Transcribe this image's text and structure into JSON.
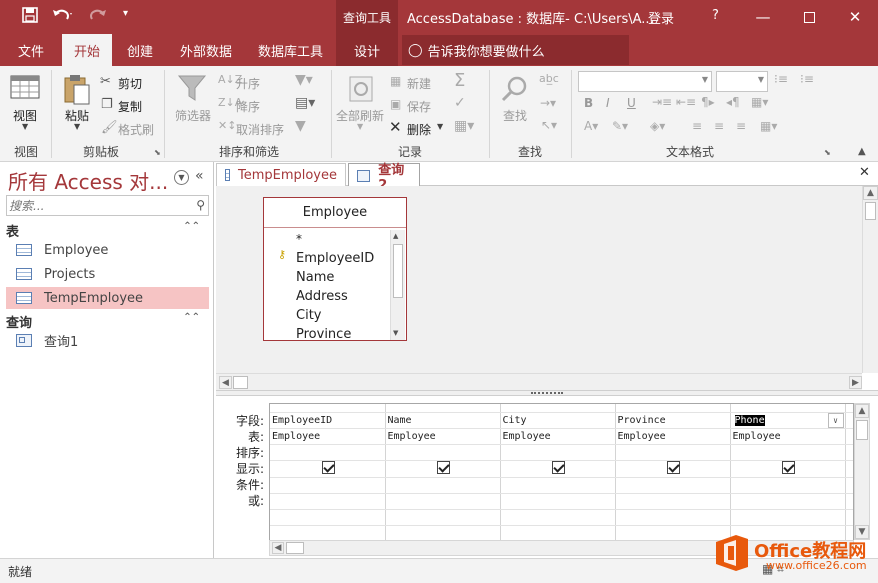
{
  "titlebar": {
    "context_tab": "查询工具",
    "title": "AccessDatabase : 数据库- C:\\Users\\A...",
    "signin": "登录",
    "help": "?"
  },
  "ribbon_tabs": [
    "文件",
    "开始",
    "创建",
    "外部数据",
    "数据库工具",
    "设计"
  ],
  "tell_me": "告诉我你想要做什么",
  "ribbon": {
    "view": {
      "label": "视图",
      "group": "视图"
    },
    "clipboard": {
      "paste": "粘贴",
      "cut": "剪切",
      "copy": "复制",
      "format_painter": "格式刷",
      "group": "剪贴板"
    },
    "sort": {
      "filter": "筛选器",
      "asc": "升序",
      "desc": "降序",
      "remove_sort": "取消排序",
      "group": "排序和筛选"
    },
    "records": {
      "refresh": "全部刷新",
      "new": "新建",
      "save": "保存",
      "delete": "删除",
      "group": "记录"
    },
    "find": {
      "find": "查找",
      "group": "查找"
    },
    "text": {
      "group": "文本格式",
      "bold": "B",
      "italic": "I",
      "underline": "U"
    }
  },
  "nav": {
    "title": "所有 Access 对...",
    "search_placeholder": "搜索...",
    "sections": [
      {
        "title": "表",
        "items": [
          "Employee",
          "Projects",
          "TempEmployee"
        ]
      },
      {
        "title": "查询",
        "items": [
          "查询1"
        ]
      }
    ]
  },
  "doc_tabs": [
    "TempEmployee",
    "查询2"
  ],
  "table_box": {
    "title": "Employee",
    "fields": [
      "*",
      "EmployeeID",
      "Name",
      "Address",
      "City",
      "Province"
    ]
  },
  "grid": {
    "row_labels": [
      "字段:",
      "表:",
      "排序:",
      "显示:",
      "条件:",
      "或:"
    ],
    "columns": [
      {
        "field": "EmployeeID",
        "table": "Employee",
        "show": true
      },
      {
        "field": "Name",
        "table": "Employee",
        "show": true
      },
      {
        "field": "City",
        "table": "Employee",
        "show": true
      },
      {
        "field": "Province",
        "table": "Employee",
        "show": true
      },
      {
        "field": "Phone",
        "table": "Employee",
        "show": true
      }
    ]
  },
  "status": {
    "text": "就绪"
  },
  "watermark": {
    "brand": "Office教程网",
    "url": "www.office26.com"
  },
  "colors": {
    "accent": "#a4373a",
    "selected_nav": "#f6c4c4"
  }
}
